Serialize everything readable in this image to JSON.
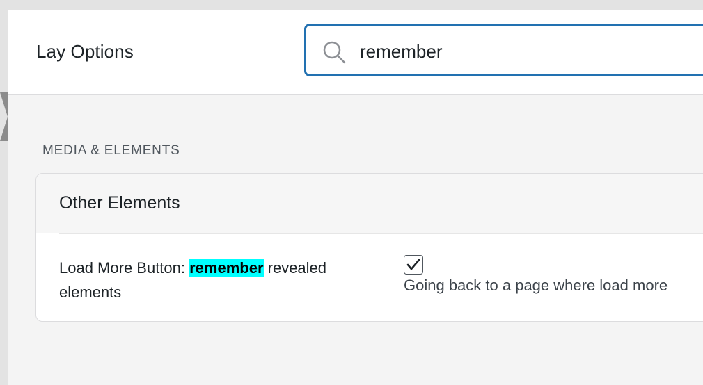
{
  "header": {
    "title": "Lay Options",
    "search_value": "remember",
    "search_icon": "search-icon"
  },
  "section": {
    "label": "MEDIA & ELEMENTS"
  },
  "card": {
    "title": "Other Elements",
    "option": {
      "label_before": "Load More Button: ",
      "label_highlight": "remember",
      "label_after": " revealed elements",
      "checked": true,
      "description": "Going back to a page where load more"
    }
  },
  "colors": {
    "accent": "#2271b1",
    "highlight": "#00ffff"
  }
}
